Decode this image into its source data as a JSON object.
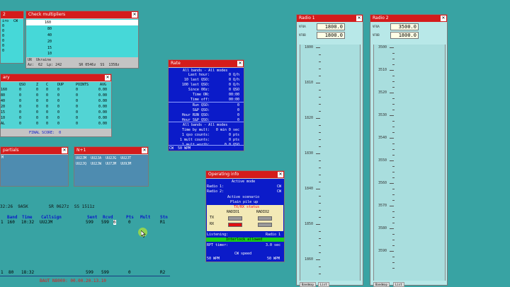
{
  "left_partial": {
    "rows": [
      "2",
      "iro",
      "CW",
      "0",
      "0",
      "0",
      "0",
      "0",
      "0"
    ]
  },
  "check_multipliers": {
    "title": "Check multipliers",
    "values": [
      "160",
      "80",
      "40",
      "20",
      "15",
      "10"
    ],
    "country": "UR  Ukraine",
    "info": "Az:  62  Lp: 242        SR 0546z  SS  1358z"
  },
  "summary": {
    "title": "ary",
    "headers": [
      "",
      "QSO",
      "Z",
      "C",
      "DUP",
      "POINTS",
      "AVG"
    ],
    "rows": [
      [
        "160",
        "0",
        "0",
        "0",
        "0",
        "0",
        "0.00"
      ],
      [
        "80",
        "0",
        "0",
        "0",
        "0",
        "0",
        "0.00"
      ],
      [
        "40",
        "0",
        "0",
        "0",
        "0",
        "0",
        "0.00"
      ],
      [
        "20",
        "0",
        "0",
        "0",
        "0",
        "0",
        "0.00"
      ],
      [
        "15",
        "0",
        "0",
        "0",
        "0",
        "0",
        "0.00"
      ],
      [
        "10",
        "0",
        "0",
        "0",
        "0",
        "0",
        "0.00"
      ],
      [
        "AL",
        "0",
        "0",
        "0",
        "0",
        "0",
        "0.00"
      ]
    ],
    "final_score": "FINAL SCORE:  0"
  },
  "partials": {
    "title": "partials",
    "entry": "M"
  },
  "n1": {
    "title": "N+1",
    "row1": "UU2JM  UU2JA  UU2JG  UU2JT",
    "row2": "UU2JQ  UU2JW  UU7JM  UU9JM"
  },
  "rate": {
    "title": "Rate",
    "section1_title": "All bands - All modes",
    "section1": [
      [
        "Last hour:",
        "0 Q/h"
      ],
      [
        "10 last QSO:",
        "0 Q/h"
      ],
      [
        "100 last QSO:",
        "0 Q/h"
      ],
      [
        "Since 00z:",
        "0 QSO"
      ],
      [
        "Time ON:",
        "00:00"
      ],
      [
        "Time off:",
        "00:00"
      ]
    ],
    "section2": [
      [
        "Run QSO:",
        "0"
      ],
      [
        "S&P QSO:",
        "0"
      ],
      [
        "Hour RUN QSO:",
        "0"
      ],
      [
        "Hour S&P QSO:",
        "0"
      ]
    ],
    "section3_title": "All bands - All modes",
    "section3": [
      [
        "Time by mult:",
        "0 min 0 sec"
      ],
      [
        "1 qso counts:",
        "0 pts"
      ],
      [
        "1 mult counts:",
        "0 pts"
      ],
      [
        "1 mult worth:",
        "0.0 QSO"
      ]
    ],
    "footer": "CW  50 WPM"
  },
  "operating_info": {
    "title": "Operating info",
    "active_mode": "Active mode",
    "radio1_label": "Radio 1:",
    "radio1_mode": "CW",
    "radio2_label": "Radio 2:",
    "radio2_mode": "CW",
    "scenario_title": "Active scenario",
    "scenario": "Plain pile up",
    "txrx_title": "TX/RX status",
    "radio1": "RADIO1",
    "radio2": "RADIO2",
    "tx": "TX",
    "rx": "RX",
    "listening_label": "Listening:",
    "listening_value": "Radio 1",
    "interlock": "Interlock allowed",
    "rpt_label": "RPT timer:",
    "rpt_value": "3.0 sec",
    "cw_speed": "CW speed",
    "wpm1": "50 WPM",
    "wpm2": "50 WPM"
  },
  "radio1": {
    "title": "Radio 1",
    "vfoa_label": "VFOA",
    "vfoa": "1800.0",
    "vfob_label": "VFOB",
    "vfob": "1800.0",
    "scale": [
      "1800",
      "1810",
      "1820",
      "1830",
      "1840",
      "1850",
      "1860"
    ],
    "tab1": "Bandmap",
    "tab2": "List"
  },
  "radio2": {
    "title": "Radio 2",
    "vfoa_label": "VFOA",
    "vfoa": "3500.0",
    "vfob_label": "VFOB",
    "vfob": "1800.0",
    "scale": [
      "3500",
      "3510",
      "3520",
      "3530",
      "3540",
      "3550",
      "3560",
      "3570",
      "3580",
      "3590"
    ],
    "tab1": "Bandmap",
    "tab2": "List"
  },
  "status_line": "32:26  9A5K        SR 0627z  SS 1511z",
  "log": {
    "headers": [
      "Band",
      "Time",
      "Callsign",
      "Sent",
      "Rcvd",
      "Pts",
      "Mult",
      "Stn"
    ],
    "row": [
      "1",
      "160",
      "10:32",
      "UU2JM",
      "599",
      "599",
      "6",
      "0",
      "R1"
    ]
  },
  "bottom_row": {
    "a": "1",
    "b": "80",
    "time": "18:32",
    "sent": "599",
    "rcvd": "599",
    "pts": "0",
    "stn": "R2"
  },
  "bottom_red": "BAUT N8000: 00.00.20.13.10"
}
